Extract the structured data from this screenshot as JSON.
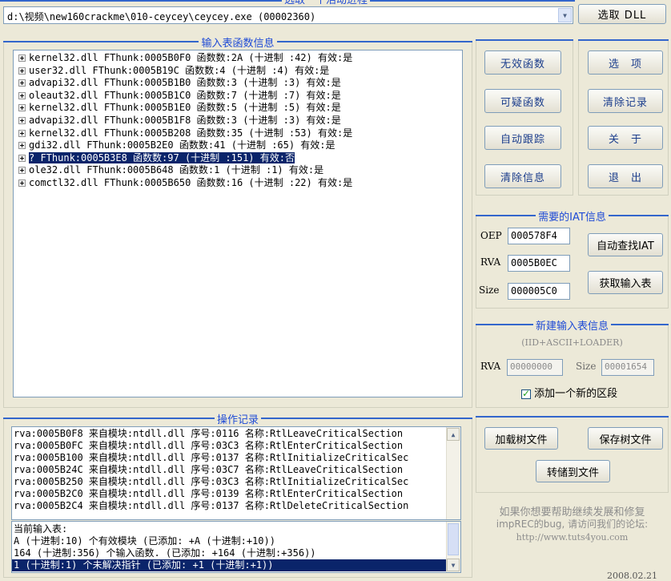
{
  "process": {
    "header_title": "选取一个活动进程",
    "selected_path": "d:\\视频\\new160crackme\\010-ceycey\\ceycey.exe (00002360)",
    "select_dll_label": "选取 DLL"
  },
  "import_panel": {
    "title": "输入表函数信息",
    "modules": [
      {
        "text": "kernel32.dll FThunk:0005B0F0 函数数:2A (十进制 :42) 有效:是",
        "selected": false
      },
      {
        "text": "user32.dll FThunk:0005B19C 函数数:4 (十进制 :4) 有效:是",
        "selected": false
      },
      {
        "text": "advapi32.dll FThunk:0005B1B0 函数数:3 (十进制 :3) 有效:是",
        "selected": false
      },
      {
        "text": "oleaut32.dll FThunk:0005B1C0 函数数:7 (十进制 :7) 有效:是",
        "selected": false
      },
      {
        "text": "kernel32.dll FThunk:0005B1E0 函数数:5 (十进制 :5) 有效:是",
        "selected": false
      },
      {
        "text": "advapi32.dll FThunk:0005B1F8 函数数:3 (十进制 :3) 有效:是",
        "selected": false
      },
      {
        "text": "kernel32.dll FThunk:0005B208 函数数:35 (十进制 :53) 有效:是",
        "selected": false
      },
      {
        "text": "gdi32.dll FThunk:0005B2E0 函数数:41 (十进制 :65) 有效:是",
        "selected": false
      },
      {
        "text": "? FThunk:0005B3E8 函数数:97 (十进制 :151) 有效:否",
        "selected": true
      },
      {
        "text": "ole32.dll FThunk:0005B648 函数数:1 (十进制 :1) 有效:是",
        "selected": false
      },
      {
        "text": "comctl32.dll FThunk:0005B650 函数数:16 (十进制 :22) 有效:是",
        "selected": false
      }
    ]
  },
  "side_buttons": {
    "invalid_functions": "无效函数",
    "options": "选　项",
    "suspicious_functions": "可疑函数",
    "clear_log": "清除记录",
    "auto_trace": "自动跟踪",
    "about": "关　于",
    "clear_info": "清除信息",
    "exit": "退　出"
  },
  "iat_info": {
    "title": "需要的IAT信息",
    "oep_label": "OEP",
    "oep_value": "000578F4",
    "rva_label": "RVA",
    "rva_value": "0005B0EC",
    "size_label": "Size",
    "size_value": "000005C0",
    "auto_search_label": "自动查找IAT",
    "get_imports_label": "获取输入表"
  },
  "new_import": {
    "title": "新建输入表信息",
    "subtitle": "(IID+ASCII+LOADER)",
    "rva_label": "RVA",
    "rva_value": "00000000",
    "size_label": "Size",
    "size_value": "00001654",
    "add_section_label": "添加一个新的区段",
    "add_section_checked": true
  },
  "log": {
    "title": "操作记录",
    "lines": [
      "rva:0005B0F8 来自模块:ntdll.dll 序号:0116 名称:RtlLeaveCriticalSection",
      "rva:0005B0FC 来自模块:ntdll.dll 序号:03C3 名称:RtlEnterCriticalSection",
      "rva:0005B100 来自模块:ntdll.dll 序号:0137 名称:RtlInitializeCriticalSec",
      "rva:0005B24C 来自模块:ntdll.dll 序号:03C7 名称:RtlLeaveCriticalSection",
      "rva:0005B250 来自模块:ntdll.dll 序号:03C3 名称:RtlInitializeCriticalSec",
      "rva:0005B2C0 来自模块:ntdll.dll 序号:0139 名称:RtlEnterCriticalSection",
      "rva:0005B2C4 来自模块:ntdll.dll 序号:0137 名称:RtlDeleteCriticalSection"
    ],
    "summary_lines": [
      {
        "text": "当前输入表:",
        "selected": false
      },
      {
        "text": "A (十进制:10) 个有效模块 (已添加: +A (十进制:+10))",
        "selected": false
      },
      {
        "text": "164 (十进制:356) 个输入函数. (已添加: +164 (十进制:+356))",
        "selected": false
      },
      {
        "text": "1 (十进制:1) 个未解决指针 (已添加: +1 (十进制:+1))",
        "selected": true
      }
    ]
  },
  "tree_buttons": {
    "load_tree": "加载树文件",
    "save_tree": "保存树文件",
    "dump_to_file": "转储到文件"
  },
  "footer": {
    "message_line1": "如果你想要帮助继续发展和修复",
    "message_line2": "impREC的bug, 请访问我们的论坛:",
    "url": "http://www.tuts4you.com",
    "date": "2008.02.21"
  }
}
